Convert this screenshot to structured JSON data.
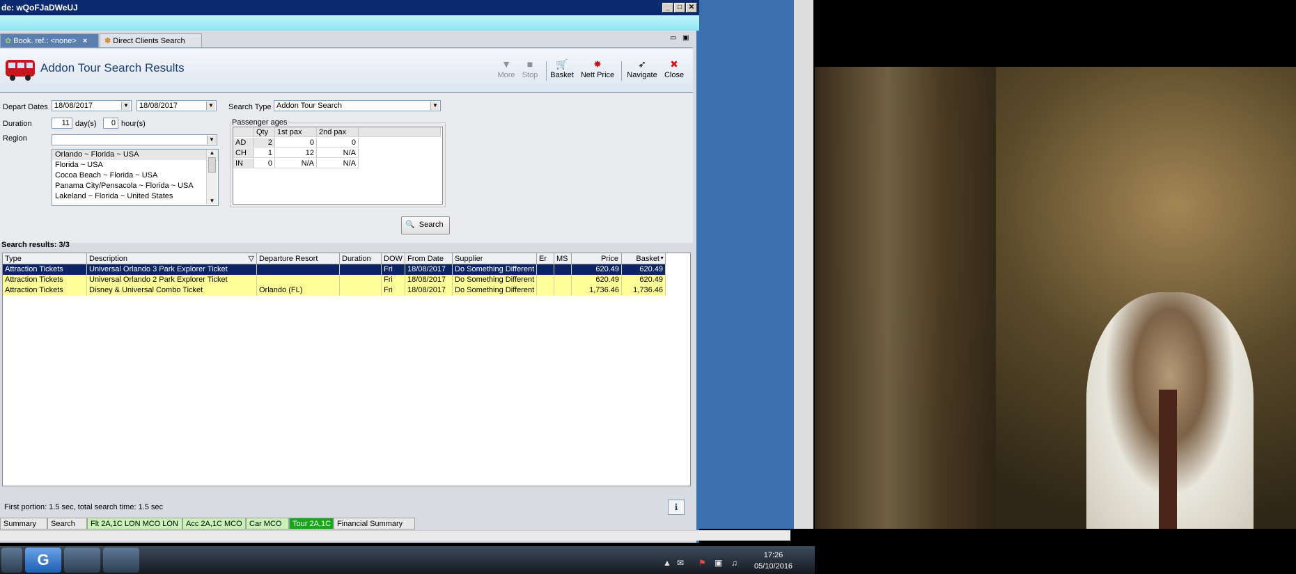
{
  "window": {
    "title": "de: wQoFJaDWeUJ",
    "min_glyph": "_",
    "max_glyph": "□",
    "close_glyph": "✕"
  },
  "tabs": [
    {
      "label": "Book. ref.: <none>",
      "icon": "palm-tree-icon",
      "active": true
    },
    {
      "label": "Direct Clients Search",
      "icon": "clients-icon",
      "active": false
    }
  ],
  "header": {
    "title": "Addon Tour Search Results",
    "icon": "bus-icon",
    "toolbar": [
      {
        "label": "More",
        "icon": "chevron-down-icon",
        "disabled": true
      },
      {
        "label": "Stop",
        "icon": "stop-icon",
        "disabled": true
      },
      {
        "label": "Basket",
        "icon": "basket-icon",
        "disabled": false
      },
      {
        "label": "Nett Price",
        "icon": "price-icon",
        "disabled": false
      },
      {
        "label": "Navigate",
        "icon": "navigate-icon",
        "disabled": false
      },
      {
        "label": "Close",
        "icon": "close-icon",
        "disabled": false
      }
    ]
  },
  "form": {
    "depart_label": "Depart Dates",
    "depart_from": "18/08/2017",
    "depart_to": "18/08/2017",
    "search_type_label": "Search Type",
    "search_type_value": "Addon Tour Search",
    "duration_label": "Duration",
    "duration_days": "11",
    "days_unit": "day(s)",
    "duration_hours": "0",
    "hours_unit": "hour(s)",
    "region_label": "Region",
    "region_value": "",
    "regions": [
      "Orlando ~ Florida ~ USA",
      "Florida ~ USA",
      "Cocoa Beach ~ Florida ~ USA",
      "Panama City/Pensacola ~  Florida  ~ USA",
      "Lakeland ~ Florida ~ United States"
    ],
    "pax_group_label": "Passenger ages",
    "pax_headers": [
      "",
      "Qty",
      "1st pax",
      "2nd pax"
    ],
    "pax_rows": [
      [
        "AD",
        "2",
        "0",
        "0"
      ],
      [
        "CH",
        "1",
        "12",
        "N/A"
      ],
      [
        "IN",
        "0",
        "N/A",
        "N/A"
      ]
    ],
    "search_button": "Search"
  },
  "results": {
    "label": "Search results: 3/3",
    "columns": [
      "Type",
      "Description",
      "Departure Resort",
      "Duration",
      "DOW",
      "From Date",
      "Supplier",
      "Er",
      "MS",
      "Price",
      "Basket"
    ],
    "rows": [
      {
        "type": "Attraction Tickets",
        "description": "Universal Orlando 3 Park Explorer Ticket",
        "resort": "",
        "duration": "",
        "dow": "Fri",
        "from": "18/08/2017",
        "supplier": "Do Something Different",
        "er": "",
        "ms": "",
        "price": "620.49",
        "basket": "620.49",
        "state": "selected"
      },
      {
        "type": "Attraction Tickets",
        "description": "Universal Orlando 2 Park Explorer Ticket",
        "resort": "",
        "duration": "",
        "dow": "Fri",
        "from": "18/08/2017",
        "supplier": "Do Something Different",
        "er": "",
        "ms": "",
        "price": "620.49",
        "basket": "620.49",
        "state": "normal"
      },
      {
        "type": "Attraction Tickets",
        "description": "Disney & Universal Combo Ticket",
        "resort": "Orlando (FL)",
        "duration": "",
        "dow": "Fri",
        "from": "18/08/2017",
        "supplier": "Do Something Different",
        "er": "",
        "ms": "",
        "price": "1,736.46",
        "basket": "1,736.46",
        "state": "normal"
      }
    ]
  },
  "status": "First portion: 1.5 sec, total search time: 1.5 sec",
  "bottom_tabs": [
    {
      "label": "Summary",
      "style": "plain"
    },
    {
      "label": "Search",
      "style": "plain"
    },
    {
      "label": "Flt 2A,1C LON MCO LON",
      "style": "green"
    },
    {
      "label": "Acc 2A,1C MCO",
      "style": "green"
    },
    {
      "label": "Car MCO",
      "style": "green"
    },
    {
      "label": "Tour 2A,1C",
      "style": "darkgreen"
    },
    {
      "label": "Financial Summary",
      "style": "plain"
    }
  ],
  "taskbar": {
    "time": "17:26",
    "date": "05/10/2016"
  }
}
